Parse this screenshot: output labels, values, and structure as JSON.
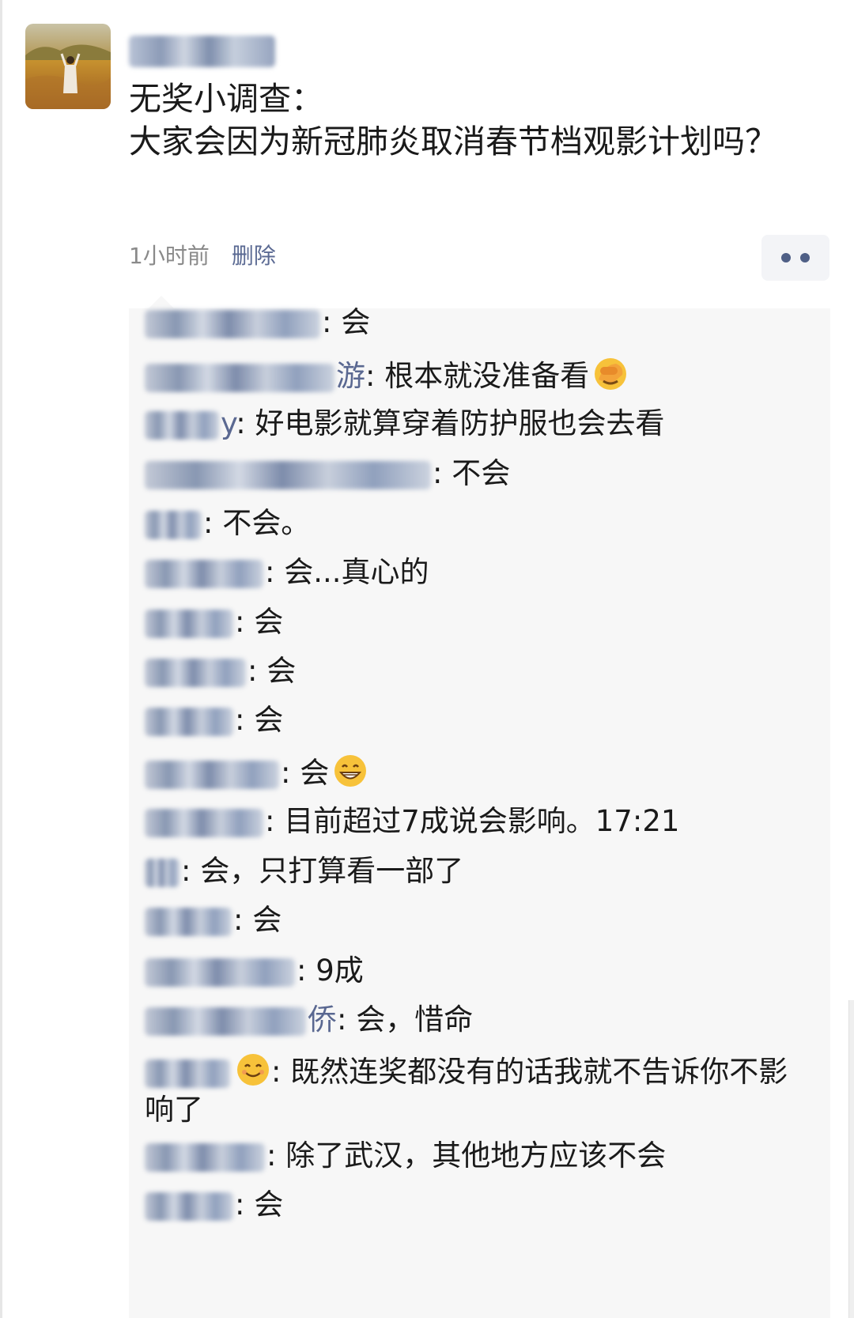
{
  "post": {
    "text": "无奖小调查：\n大家会因为新冠肺炎取消春节档观影计划吗？",
    "time": "1小时前",
    "delete_label": "删除"
  },
  "icons": {
    "more": "more-dots-icon",
    "emoji_facepalm": "facepalm-emoji-icon",
    "emoji_grin": "grinning-emoji-icon",
    "emoji_smile": "smiling-emoji-icon"
  },
  "comments": [
    {
      "name_visible": "",
      "text": ": 会"
    },
    {
      "name_visible": "游",
      "text": ": 根本就没准备看"
    },
    {
      "name_visible": "y",
      "text": ": 好电影就算穿着防护服也会去看"
    },
    {
      "name_visible": "",
      "text": ": 不会"
    },
    {
      "name_visible": "",
      "text": ": 不会。"
    },
    {
      "name_visible": "",
      "text": ": 会...真心的"
    },
    {
      "name_visible": "",
      "text": ": 会"
    },
    {
      "name_visible": "",
      "text": ": 会"
    },
    {
      "name_visible": "",
      "text": ": 会"
    },
    {
      "name_visible": "",
      "text": ": 会"
    },
    {
      "name_visible": "",
      "text": ": 目前超过7成说会影响。17:21"
    },
    {
      "name_visible": "",
      "text": ": 会，只打算看一部了"
    },
    {
      "name_visible": "",
      "text": ": 会"
    },
    {
      "name_visible": "",
      "text": ": 9成"
    },
    {
      "name_visible": "侨",
      "text": ": 会，惜命"
    },
    {
      "name_visible": "",
      "text": ": 既然连奖都没有的话我就不告诉你不影响了"
    },
    {
      "name_visible": "",
      "text": ": 除了武汉，其他地方应该不会"
    },
    {
      "name_visible": "",
      "text": ": 会"
    }
  ],
  "colors": {
    "link": "#5a6891",
    "panel_bg": "#f7f7f7",
    "text": "#1a1a1a",
    "meta": "#8a8a8a"
  }
}
